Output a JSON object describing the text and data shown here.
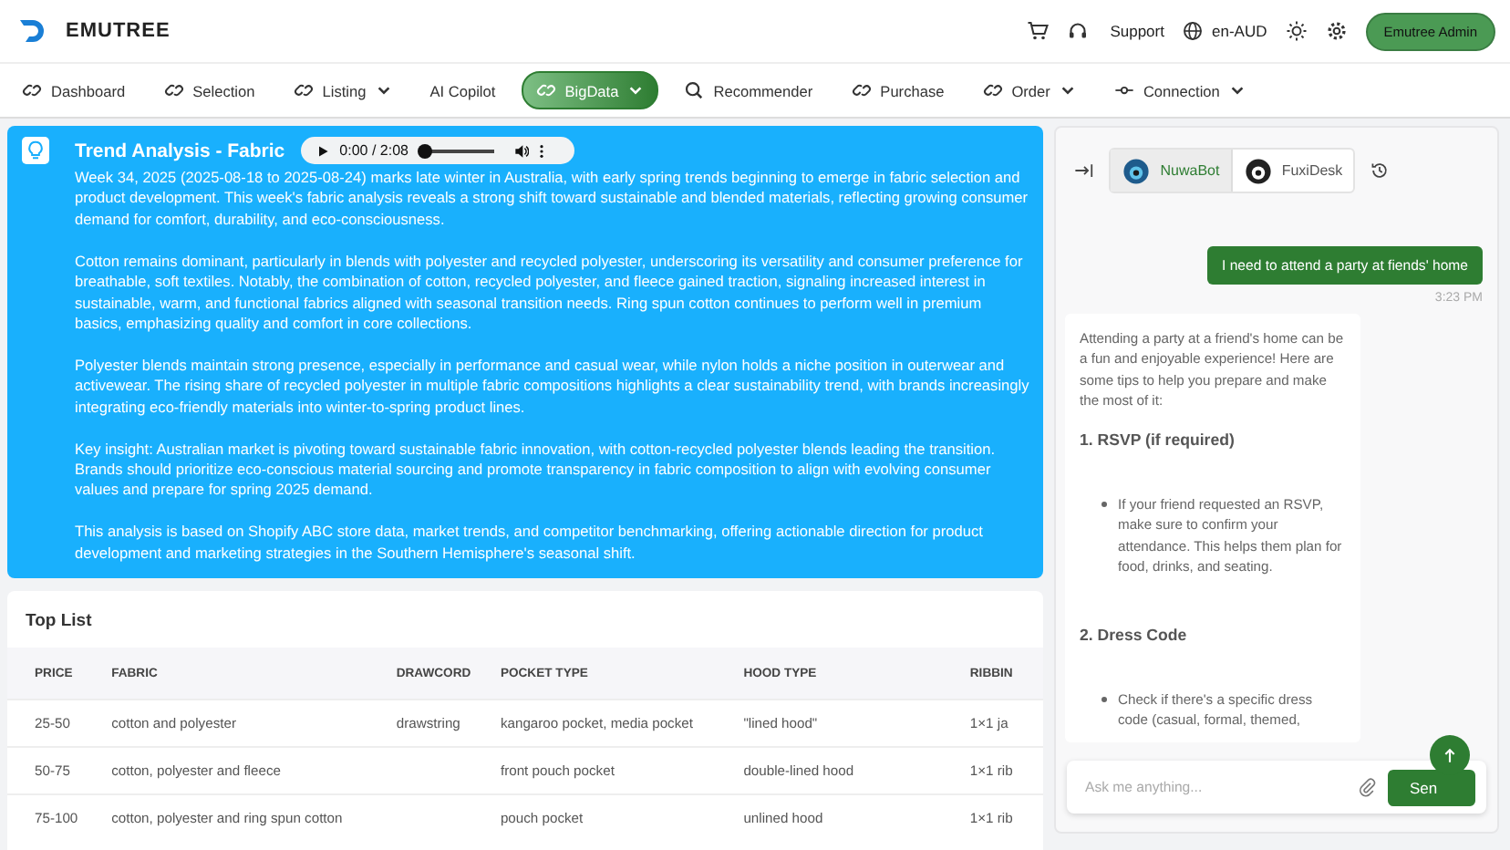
{
  "header": {
    "brand": "EMUTREE",
    "support": "Support",
    "language": "en-AUD",
    "user": "Emutree Admin"
  },
  "nav": [
    {
      "label": "Dashboard",
      "kind": "link",
      "menu": false,
      "selected": false
    },
    {
      "label": "Selection",
      "kind": "link",
      "menu": false,
      "selected": false
    },
    {
      "label": "Listing",
      "kind": "link",
      "menu": true,
      "selected": false
    },
    {
      "label": "AI Copilot",
      "kind": "plain",
      "menu": false,
      "selected": false
    },
    {
      "label": "BigData",
      "kind": "link",
      "menu": true,
      "selected": true
    },
    {
      "label": "Recommender",
      "kind": "search",
      "menu": false,
      "selected": false
    },
    {
      "label": "Purchase",
      "kind": "link",
      "menu": false,
      "selected": false
    },
    {
      "label": "Order",
      "kind": "link",
      "menu": true,
      "selected": false
    },
    {
      "label": "Connection",
      "kind": "connector",
      "menu": true,
      "selected": false
    }
  ],
  "trend": {
    "title": "Trend Analysis - Fabric",
    "audio": {
      "time": "0:00 / 2:08",
      "level": 0
    },
    "paragraphs": [
      "Week 34, 2025 (2025-08-18 to 2025-08-24) marks late winter in Australia, with early spring trends beginning to emerge in fabric selection and product development. This week's fabric analysis reveals a strong shift toward sustainable and blended materials, reflecting growing consumer demand for comfort, durability, and eco-consciousness.",
      "Cotton remains dominant, particularly in blends with polyester and recycled polyester, underscoring its versatility and consumer preference for breathable, soft textiles. Notably, the combination of cotton, recycled polyester, and fleece gained traction, signaling increased interest in sustainable, warm, and functional fabrics aligned with seasonal transition needs. Ring spun cotton continues to perform well in premium basics, emphasizing quality and comfort in core collections.",
      "Polyester blends maintain strong presence, especially in performance and casual wear, while nylon holds a niche position in outerwear and activewear. The rising share of recycled polyester in multiple fabric compositions highlights a clear sustainability trend, with brands increasingly integrating eco-friendly materials into winter-to-spring product lines.",
      "Key insight: Australian market is pivoting toward sustainable fabric innovation, with cotton-recycled polyester blends leading the transition. Brands should prioritize eco-conscious material sourcing and promote transparency in fabric composition to align with evolving consumer values and prepare for spring 2025 demand.",
      "This analysis is based on Shopify ABC store data, market trends, and competitor benchmarking, offering actionable direction for product development and marketing strategies in the Southern Hemisphere's seasonal shift."
    ]
  },
  "top_list": {
    "title": "Top List",
    "columns": [
      "PRICE",
      "FABRIC",
      "DRAWCORD",
      "POCKET TYPE",
      "HOOD TYPE",
      "RIBBIN"
    ],
    "rows": [
      [
        "25-50",
        "cotton and polyester",
        "drawstring",
        "kangaroo pocket, media pocket",
        "\"lined hood\"",
        "1×1 ja"
      ],
      [
        "50-75",
        "cotton, polyester and fleece",
        "",
        "front pouch pocket",
        "double-lined hood",
        "1×1 rib"
      ],
      [
        "75-100",
        "cotton, polyester and ring spun cotton",
        "",
        "pouch pocket",
        "unlined hood",
        "1×1 rib"
      ]
    ]
  },
  "chat": {
    "bots": [
      {
        "label": "NuwaBot",
        "selected": true
      },
      {
        "label": "FuxiDesk",
        "selected": false
      }
    ],
    "user_message": "I need to attend a party at fiends' home",
    "time": "3:23 PM",
    "reply": [
      {
        "kind": "text",
        "text": "Attending a party at a friend's home can be a fun and enjoyable experience! Here are some tips to help you prepare and make the most of it:"
      },
      {
        "kind": "heading",
        "text": "1. RSVP (if required)"
      },
      {
        "kind": "bullet",
        "text": "If your friend requested an RSVP, make sure to confirm your attendance. This helps them plan for food, drinks, and seating."
      },
      {
        "kind": "heading",
        "text": "2. Dress Code"
      },
      {
        "kind": "bullet",
        "text": "Check if there's a specific dress code (casual, formal, themed,"
      }
    ],
    "input": {
      "placeholder": "Ask me anything..."
    },
    "send": "Sen"
  }
}
